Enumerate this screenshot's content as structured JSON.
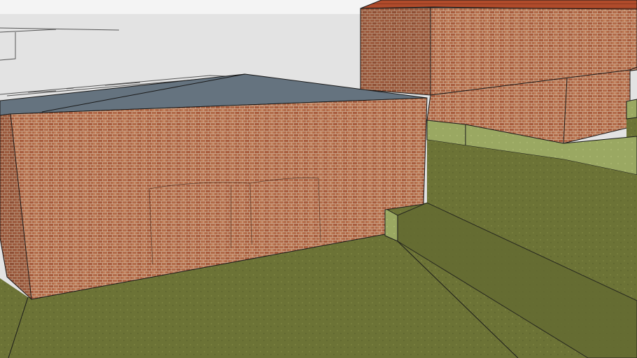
{
  "scene": {
    "kind": "3d-model-render",
    "objects": [
      "brick-building-near",
      "brick-building-far",
      "flat-roof",
      "tiled-roof",
      "grass-terrain",
      "retaining-wall",
      "sketch-outline-lines"
    ]
  },
  "colors": {
    "sky": "#e3e3e3",
    "grass": "#6d7436",
    "grass_light": "#9ba864",
    "brick": "#b06a48",
    "mortar": "#c6a58d",
    "roof_slate": "#65737f",
    "roof_tile": "#b24a2a",
    "edge": "#1a1a1a"
  }
}
